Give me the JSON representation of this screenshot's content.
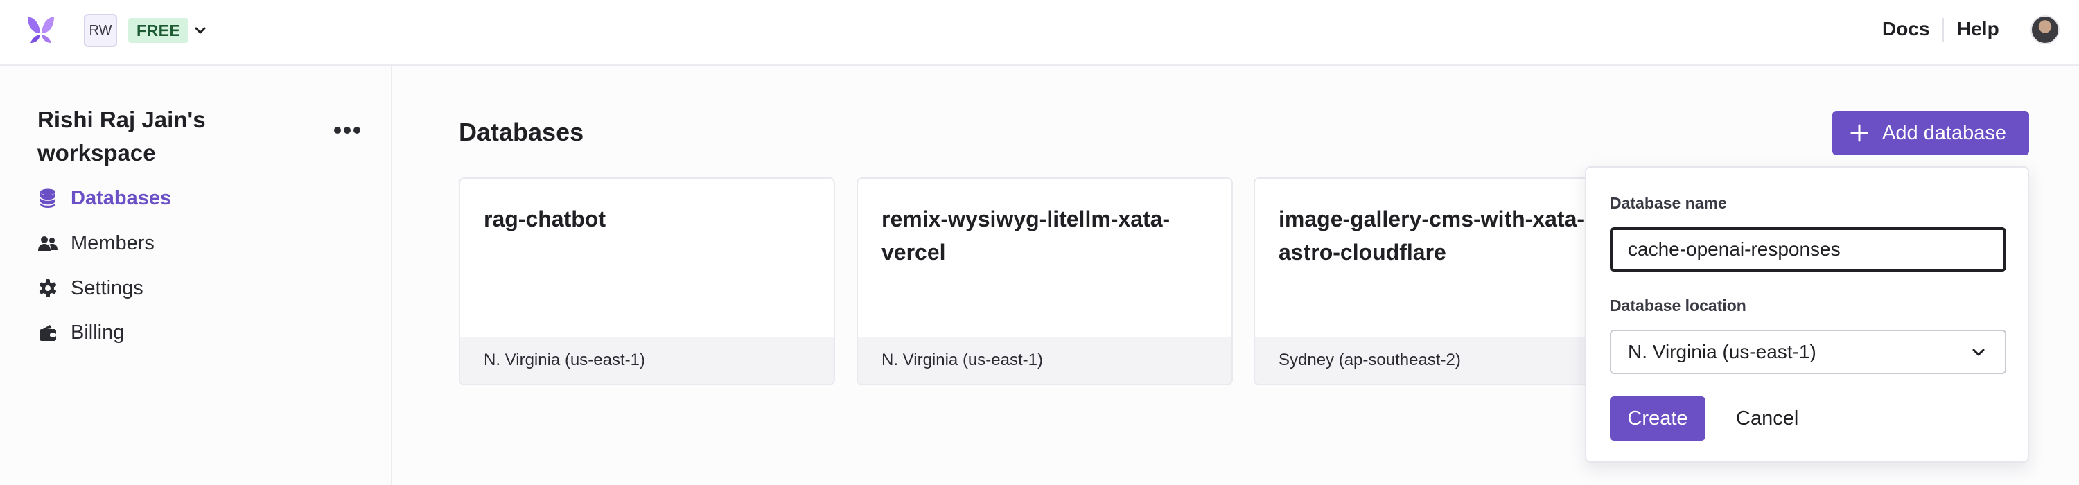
{
  "header": {
    "workspace_initials": "RW",
    "plan": "FREE",
    "links": {
      "docs": "Docs",
      "help": "Help"
    }
  },
  "sidebar": {
    "workspace_name": "Rishi Raj Jain's workspace",
    "items": [
      {
        "label": "Databases",
        "icon": "database-icon",
        "active": true
      },
      {
        "label": "Members",
        "icon": "members-icon",
        "active": false
      },
      {
        "label": "Settings",
        "icon": "gear-icon",
        "active": false
      },
      {
        "label": "Billing",
        "icon": "wallet-icon",
        "active": false
      }
    ]
  },
  "main": {
    "title": "Databases",
    "add_button_label": "Add database",
    "databases": [
      {
        "name": "rag-chatbot",
        "region": "N. Virginia (us-east-1)"
      },
      {
        "name": "remix-wysiwyg-litellm-xata-vercel",
        "region": "N. Virginia (us-east-1)"
      },
      {
        "name": "image-gallery-cms-with-xata-astro-cloudflare",
        "region": "Sydney (ap-southeast-2)"
      }
    ]
  },
  "popover": {
    "name_label": "Database name",
    "name_value": "cache-openai-responses",
    "location_label": "Database location",
    "location_value": "N. Virginia (us-east-1)",
    "create_label": "Create",
    "cancel_label": "Cancel"
  },
  "colors": {
    "accent": "#6b4fc4",
    "active_nav": "#6a4fc5",
    "plan_badge_bg": "#d6f3df",
    "plan_badge_text": "#1d5a32"
  }
}
